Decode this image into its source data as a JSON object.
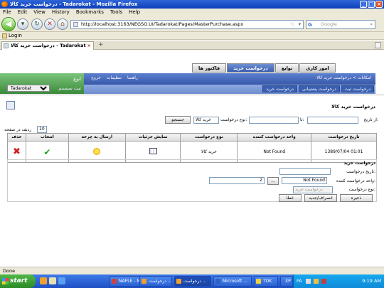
{
  "window": {
    "title": "درخواست خرید کالا - Tadarokat - Mozilla Firefox"
  },
  "menu": [
    "File",
    "Edit",
    "View",
    "History",
    "Bookmarks",
    "Tools",
    "Help"
  ],
  "nav": {
    "url": "http://localhost:3163/NEGSO.UI/Tadarokat/Pages/MasterPurchase.aspx",
    "search_placeholder": "Google",
    "search_engine_glyph": "G"
  },
  "bookmarks": {
    "items": [
      "Login"
    ]
  },
  "browser_tab": {
    "label": "درخواست خرید کالا - Tadarokat",
    "new_tab": "+"
  },
  "app": {
    "main_tabs": [
      "فاکتور ها",
      "درخواست خرید",
      "توابع",
      "امور کاری"
    ],
    "active_main_tab": 1,
    "breadcrumb": "امکانات > درخواست خرید کالا",
    "side_links": [
      "خروج",
      "تنظیمات",
      "راهنما"
    ],
    "sub_buttons": [
      "درخواست خرید",
      "درخواست پشتیبانی",
      "درخواست ثبت"
    ],
    "green_panel": {
      "label": "انوع",
      "subtitle": "ثبت سیستم",
      "select_value": "Tadarokat"
    },
    "page_title": "درخواست خرید کالا",
    "filter": {
      "from_date_label": "از تاریخ:",
      "to_label": "تا:",
      "type_label": "نوع درخواست:",
      "type_value": "خرید کالا",
      "search_button": "جستجو",
      "page_size_label": "ردیف در صفحه",
      "page_size": "10"
    },
    "table": {
      "columns": [
        "تاریخ درخواست",
        "واحد درخواست کننده",
        "نوع درخواست",
        "نمایش جزئیات",
        "ارسال به چرخه",
        "انتخاب",
        "حذف"
      ],
      "rows": [
        {
          "date": "1389/07/04 01:01",
          "unit": "Not Found",
          "type": "خرید کالا"
        }
      ]
    },
    "form": {
      "section_title": "درخواست خرید",
      "date_label": "تاریخ درخواست:",
      "unit_label": "واحد درخواست کننده:",
      "unit_value": "Not Found",
      "browse_button": "...",
      "count_value": "2",
      "type_label": "نوع درخواست:",
      "type_value": "درخواست خرید",
      "buttons": [
        "ذخیره",
        "انصراف/جدید",
        "خطا"
      ]
    }
  },
  "status": "Done",
  "taskbar": {
    "start": "start",
    "tasks": [
      "NAPLE - Mi...",
      "درخواست ...",
      "درخواست ...",
      "Microsoft ...",
      "TDK",
      "XP"
    ],
    "active_task": 2,
    "lang": "FA",
    "clock": "9:19 AM"
  }
}
